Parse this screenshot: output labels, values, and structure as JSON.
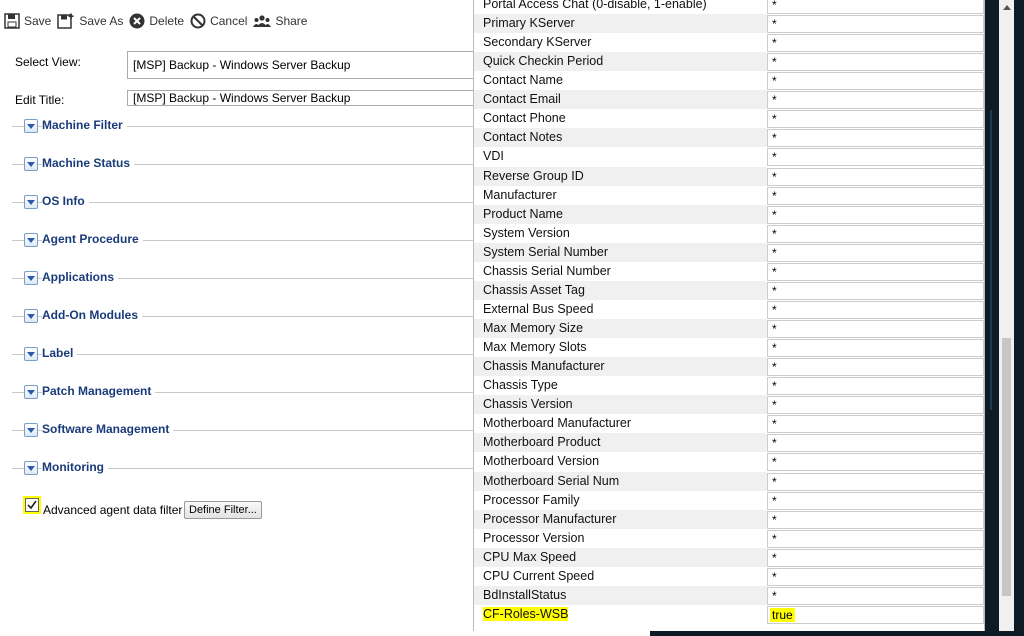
{
  "toolbar": {
    "save": "Save",
    "save_as": "Save As",
    "delete": "Delete",
    "cancel": "Cancel",
    "share": "Share"
  },
  "form": {
    "select_view_label": "Select View:",
    "select_view_value": "[MSP] Backup - Windows Server Backup",
    "edit_title_label": "Edit Title:",
    "edit_title_value": "[MSP] Backup - Windows Server Backup"
  },
  "sections": [
    {
      "title": "Machine Filter"
    },
    {
      "title": "Machine Status"
    },
    {
      "title": "OS Info"
    },
    {
      "title": "Agent Procedure"
    },
    {
      "title": "Applications"
    },
    {
      "title": "Add-On Modules"
    },
    {
      "title": "Label"
    },
    {
      "title": "Patch Management"
    },
    {
      "title": "Software Management"
    },
    {
      "title": "Monitoring"
    }
  ],
  "advanced_filter": {
    "checked": true,
    "label": "Advanced agent data filter",
    "button": "Define Filter..."
  },
  "properties": [
    {
      "key": "Portal Access Chat (0-disable, 1-enable)",
      "value": "*"
    },
    {
      "key": "Primary KServer",
      "value": "*"
    },
    {
      "key": "Secondary KServer",
      "value": "*"
    },
    {
      "key": "Quick Checkin Period",
      "value": "*"
    },
    {
      "key": "Contact Name",
      "value": "*"
    },
    {
      "key": "Contact Email",
      "value": "*"
    },
    {
      "key": "Contact Phone",
      "value": "*"
    },
    {
      "key": "Contact Notes",
      "value": "*"
    },
    {
      "key": "VDI",
      "value": "*"
    },
    {
      "key": "Reverse Group ID",
      "value": "*"
    },
    {
      "key": "Manufacturer",
      "value": "*"
    },
    {
      "key": "Product Name",
      "value": "*"
    },
    {
      "key": "System Version",
      "value": "*"
    },
    {
      "key": "System Serial Number",
      "value": "*"
    },
    {
      "key": "Chassis Serial Number",
      "value": "*"
    },
    {
      "key": "Chassis Asset Tag",
      "value": "*"
    },
    {
      "key": "External Bus Speed",
      "value": "*"
    },
    {
      "key": "Max Memory Size",
      "value": "*"
    },
    {
      "key": "Max Memory Slots",
      "value": "*"
    },
    {
      "key": "Chassis Manufacturer",
      "value": "*"
    },
    {
      "key": "Chassis Type",
      "value": "*"
    },
    {
      "key": "Chassis Version",
      "value": "*"
    },
    {
      "key": "Motherboard Manufacturer",
      "value": "*"
    },
    {
      "key": "Motherboard Product",
      "value": "*"
    },
    {
      "key": "Motherboard Version",
      "value": "*"
    },
    {
      "key": "Motherboard Serial Num",
      "value": "*"
    },
    {
      "key": "Processor Family",
      "value": "*"
    },
    {
      "key": "Processor Manufacturer",
      "value": "*"
    },
    {
      "key": "Processor Version",
      "value": "*"
    },
    {
      "key": "CPU Max Speed",
      "value": "*"
    },
    {
      "key": "CPU Current Speed",
      "value": "*"
    },
    {
      "key": "BdInstallStatus",
      "value": "*"
    },
    {
      "key": "CF-Roles-WSB",
      "value": "true",
      "highlight": true
    }
  ],
  "colors": {
    "section_title": "#1a3b7a",
    "highlight": "#ffff00",
    "background_dark": "#0e1a24"
  }
}
